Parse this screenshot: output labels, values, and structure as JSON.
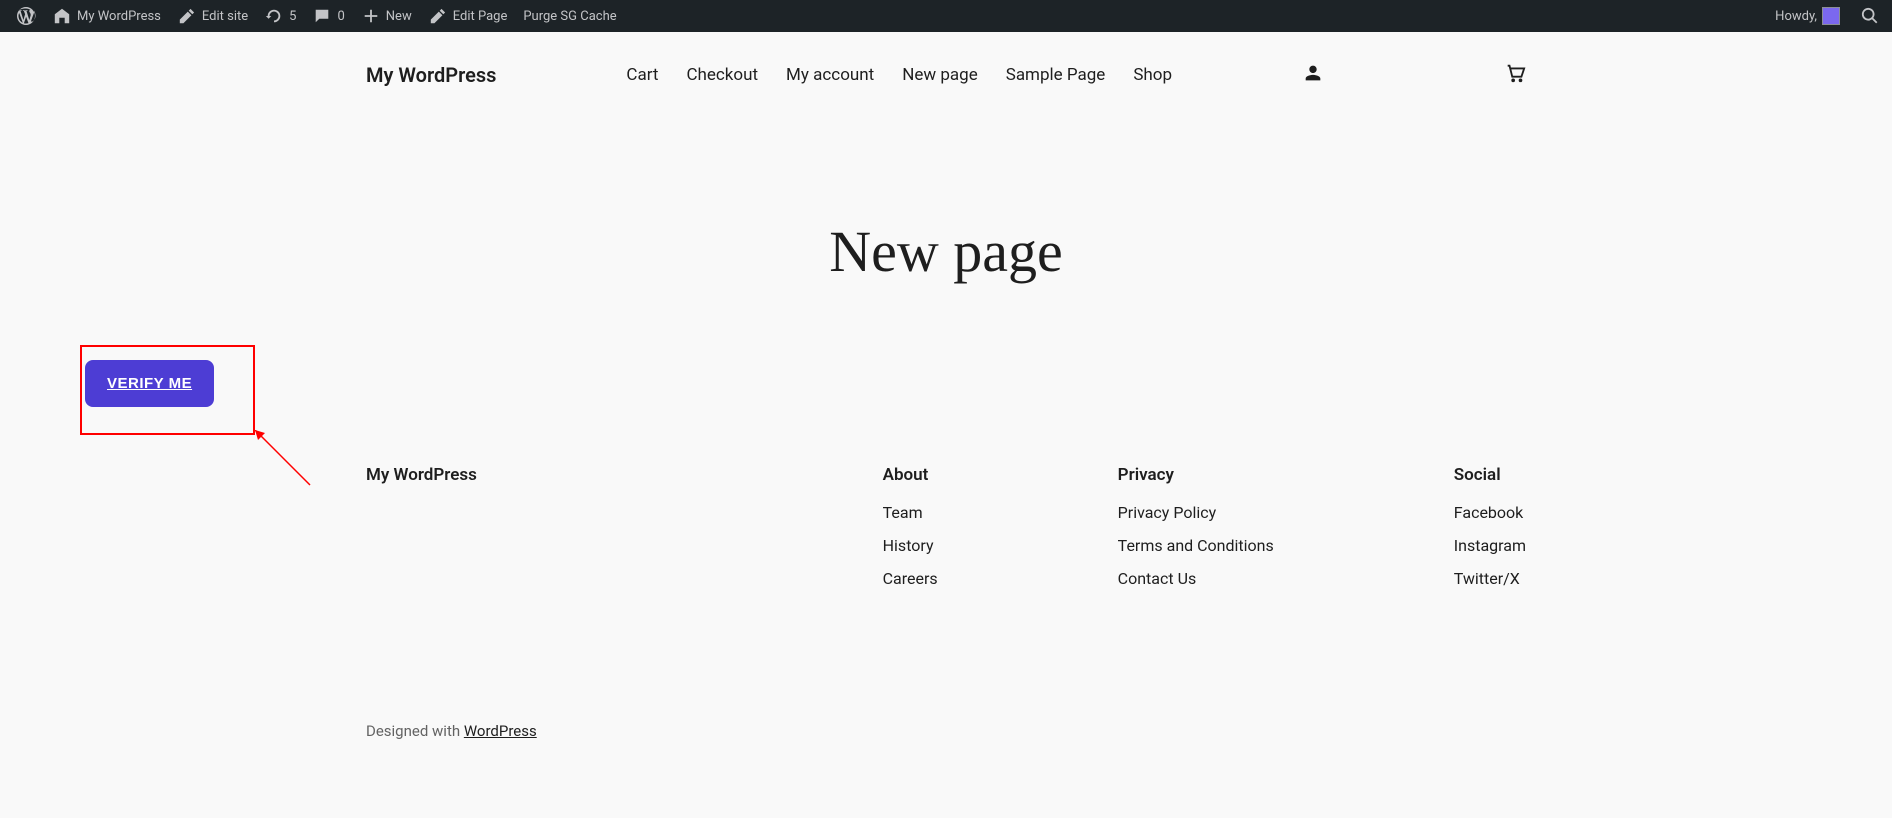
{
  "adminBar": {
    "siteName": "My WordPress",
    "editSite": "Edit site",
    "updates": "5",
    "comments": "0",
    "new": "New",
    "editPage": "Edit Page",
    "purgeCache": "Purge SG Cache",
    "howdy": "Howdy,"
  },
  "header": {
    "siteTitle": "My WordPress",
    "nav": {
      "cart": "Cart",
      "checkout": "Checkout",
      "myAccount": "My account",
      "newPage": "New page",
      "samplePage": "Sample Page",
      "shop": "Shop"
    }
  },
  "page": {
    "title": "New page",
    "verifyButton": "VERIFY ME"
  },
  "footer": {
    "brand": "My WordPress",
    "about": {
      "heading": "About",
      "team": "Team",
      "history": "History",
      "careers": "Careers"
    },
    "privacy": {
      "heading": "Privacy",
      "policy": "Privacy Policy",
      "terms": "Terms and Conditions",
      "contact": "Contact Us"
    },
    "social": {
      "heading": "Social",
      "facebook": "Facebook",
      "instagram": "Instagram",
      "twitter": "Twitter/X"
    },
    "credit": {
      "prefix": "Designed with ",
      "link": "WordPress"
    }
  }
}
